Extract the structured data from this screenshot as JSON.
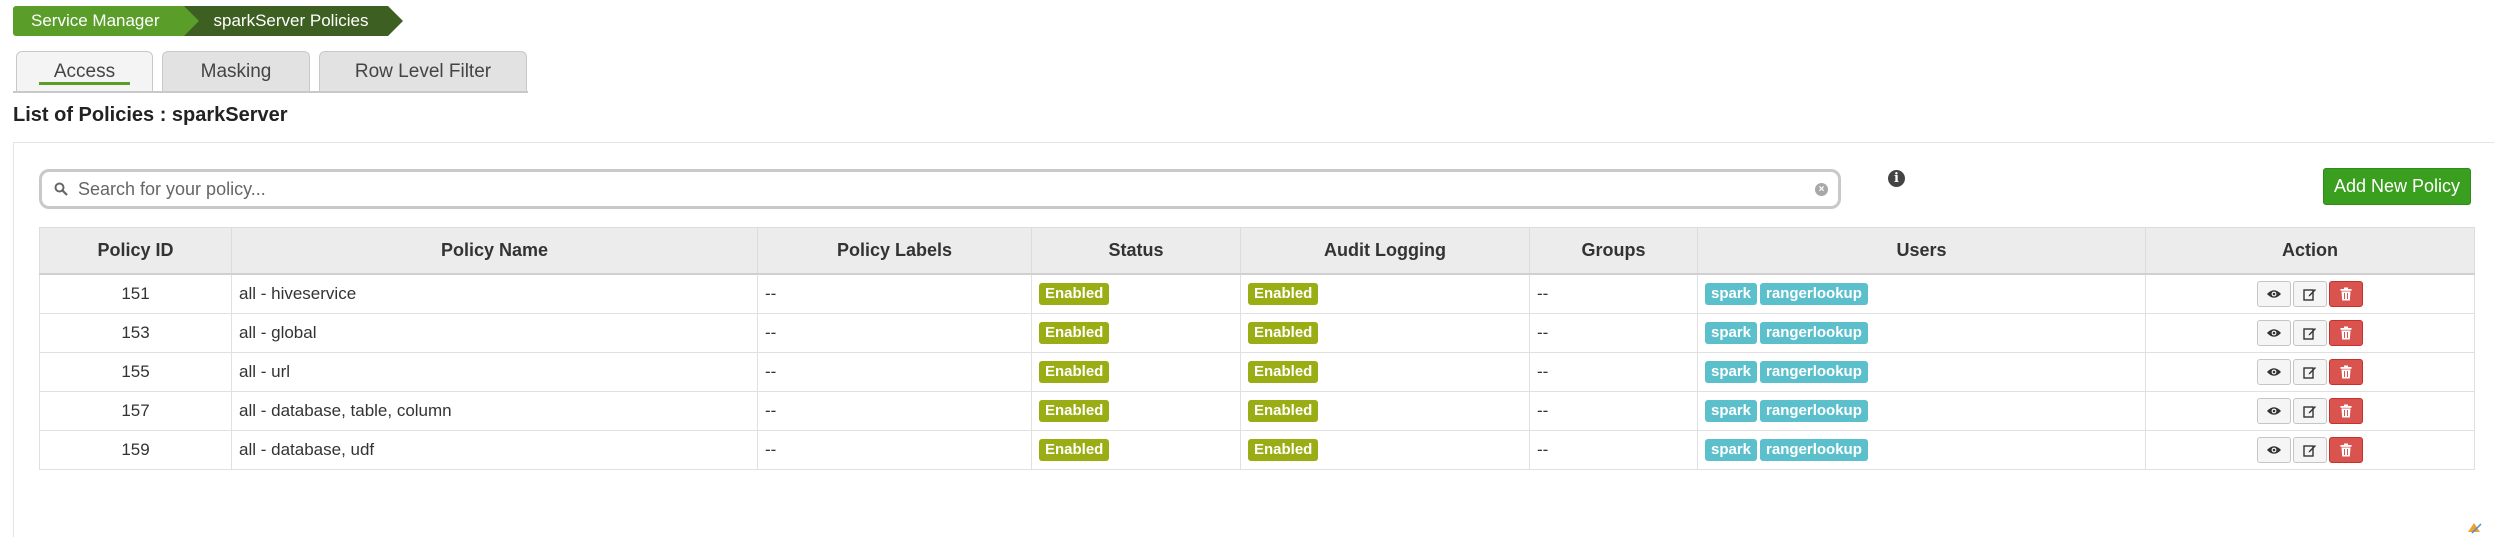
{
  "breadcrumb": {
    "items": [
      "Service Manager",
      "sparkServer Policies"
    ]
  },
  "tabs": [
    "Access",
    "Masking",
    "Row Level Filter"
  ],
  "active_tab": "Access",
  "page_title": "List of Policies : sparkServer",
  "search": {
    "placeholder": "Search for your policy...",
    "value": ""
  },
  "add_button": "Add New Policy",
  "table": {
    "headers": [
      "Policy ID",
      "Policy Name",
      "Policy Labels",
      "Status",
      "Audit Logging",
      "Groups",
      "Users",
      "Action"
    ],
    "rows": [
      {
        "id": "151",
        "name": "all - hiveservice",
        "labels": "--",
        "status": "Enabled",
        "audit": "Enabled",
        "groups": "--",
        "users": [
          "spark",
          "rangerlookup"
        ]
      },
      {
        "id": "153",
        "name": "all - global",
        "labels": "--",
        "status": "Enabled",
        "audit": "Enabled",
        "groups": "--",
        "users": [
          "spark",
          "rangerlookup"
        ]
      },
      {
        "id": "155",
        "name": "all - url",
        "labels": "--",
        "status": "Enabled",
        "audit": "Enabled",
        "groups": "--",
        "users": [
          "spark",
          "rangerlookup"
        ]
      },
      {
        "id": "157",
        "name": "all - database, table, column",
        "labels": "--",
        "status": "Enabled",
        "audit": "Enabled",
        "groups": "--",
        "users": [
          "spark",
          "rangerlookup"
        ]
      },
      {
        "id": "159",
        "name": "all - database, udf",
        "labels": "--",
        "status": "Enabled",
        "audit": "Enabled",
        "groups": "--",
        "users": [
          "spark",
          "rangerlookup"
        ]
      }
    ]
  },
  "icons": {
    "search": "search-icon",
    "clear": "clear-icon",
    "info": "info-icon",
    "view": "eye-icon",
    "edit": "edit-icon",
    "delete": "trash-icon"
  },
  "colors": {
    "brand_green": "#5a9e29",
    "dark_green": "#3d5f21",
    "button_green": "#3a9e1f",
    "status_olive": "#9aad14",
    "user_teal": "#5bbfcc",
    "danger_red": "#d9534f"
  }
}
